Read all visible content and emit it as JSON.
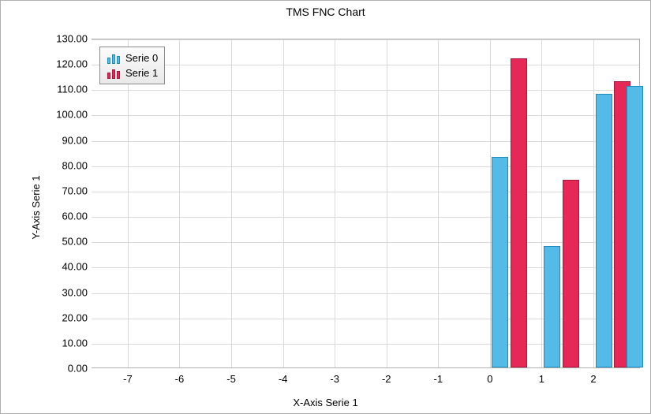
{
  "chart_data": {
    "type": "bar",
    "title": "TMS FNC Chart",
    "xlabel": "X-Axis Serie 1",
    "ylabel": "Y-Axis Serie 1",
    "x_ticks": [
      -7,
      -6,
      -5,
      -4,
      -3,
      -2,
      -1,
      0,
      1,
      2
    ],
    "x_range": [
      -7.7,
      2.9
    ],
    "y_ticks": [
      "0.00",
      "10.00",
      "20.00",
      "30.00",
      "40.00",
      "50.00",
      "60.00",
      "70.00",
      "80.00",
      "90.00",
      "100.00",
      "110.00",
      "120.00",
      "130.00"
    ],
    "ylim": [
      0,
      130
    ],
    "categories": [
      0,
      1,
      2
    ],
    "series": [
      {
        "name": "Serie 0",
        "color": "#54bbe9",
        "values": [
          83,
          48,
          108
        ]
      },
      {
        "name": "Serie 1",
        "color": "#e52855",
        "values": [
          122,
          74,
          113
        ]
      }
    ],
    "extra_bars": [
      {
        "series": 0,
        "x": 2.64,
        "value": 111
      }
    ],
    "legend_position": "top-left"
  }
}
